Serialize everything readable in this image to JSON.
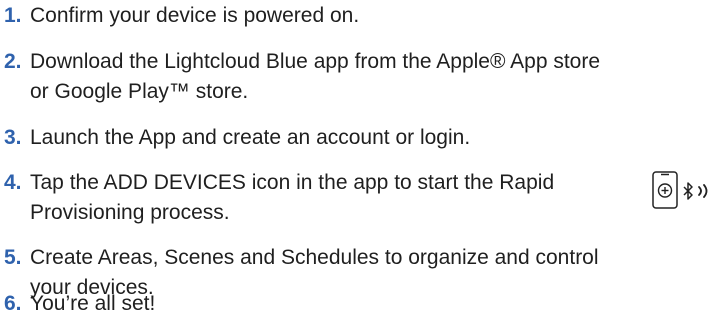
{
  "steps": [
    {
      "num": "1.",
      "lines": [
        "Confirm your device is powered on."
      ]
    },
    {
      "num": "2.",
      "lines": [
        "Download the Lightcloud Blue app from the Apple® App store",
        "or Google Play™ store."
      ]
    },
    {
      "num": "3.",
      "lines": [
        "Launch the App and create an account or login."
      ]
    },
    {
      "num": "4.",
      "lines": [
        "Tap the ADD DEVICES icon in the app to start the Rapid",
        "Provisioning process."
      ]
    },
    {
      "num": "5.",
      "lines": [
        "Create Areas, Scenes and Schedules to organize and control",
        "your devices."
      ]
    },
    {
      "num": "6.",
      "lines": [
        "You’re all set!"
      ]
    }
  ],
  "icons": {
    "device": "add-device-icon",
    "bluetooth": "bluetooth-icon",
    "signal": "signal-waves-icon"
  },
  "colors": {
    "number": "#2f62ad",
    "text": "#1f1f1f",
    "icon": "#222222"
  }
}
